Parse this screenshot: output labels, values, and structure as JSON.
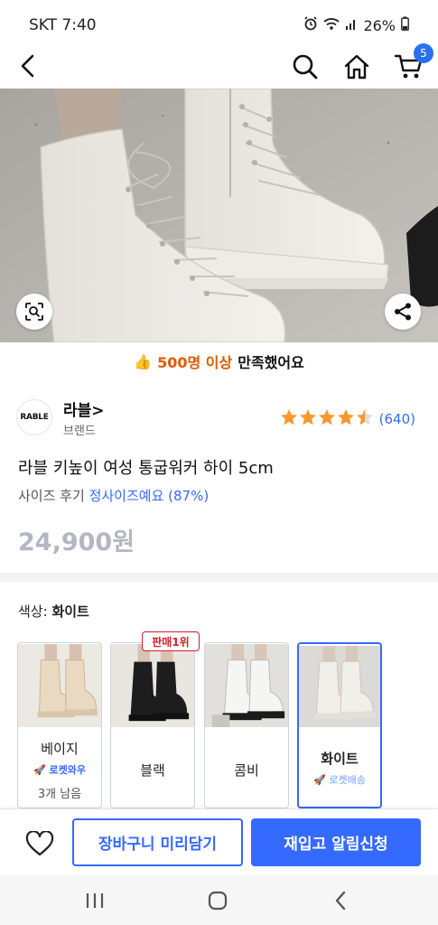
{
  "status_bar": {
    "time": "SKT 7:40",
    "battery": "26%"
  },
  "nav": {
    "cart_count": "5",
    "icons": [
      "back-icon",
      "search-icon",
      "home-icon",
      "cart-icon"
    ]
  },
  "hero": {
    "icons": [
      "image-search-icon",
      "share-icon"
    ]
  },
  "satisfaction": {
    "emoji": "👍",
    "count": "500명 이상",
    "suffix": "만족했어요"
  },
  "brand": {
    "logo_text": "RABLE",
    "name": "라블",
    "chevron": ">",
    "sub": "브랜드",
    "rating_stars": 4.5,
    "review_count": "(640)"
  },
  "product": {
    "title": "라블 키높이 여성 통굽워커 하이 5cm",
    "size_review_label": "사이즈 후기",
    "size_review_value": "정사이즈예요 (87%)",
    "price": "24,900원"
  },
  "options": {
    "label": "색상:",
    "selected": "화이트",
    "best_badge": "판매1위",
    "items": [
      {
        "name": "베이지",
        "delivery": "로켓와우",
        "stock": "3개 남음"
      },
      {
        "name": "블랙"
      },
      {
        "name": "콤비"
      },
      {
        "name": "화이트",
        "delivery": "로켓배송"
      }
    ]
  },
  "bottom": {
    "cart_button": "장바구니 미리담기",
    "restock_button": "재입고 알림신청"
  },
  "colors": {
    "accent": "#346aff",
    "badge_red": "#d21f2a",
    "highlight_orange": "#e05a00",
    "star": "#f7982f",
    "price_gray": "#b2b7c2"
  }
}
